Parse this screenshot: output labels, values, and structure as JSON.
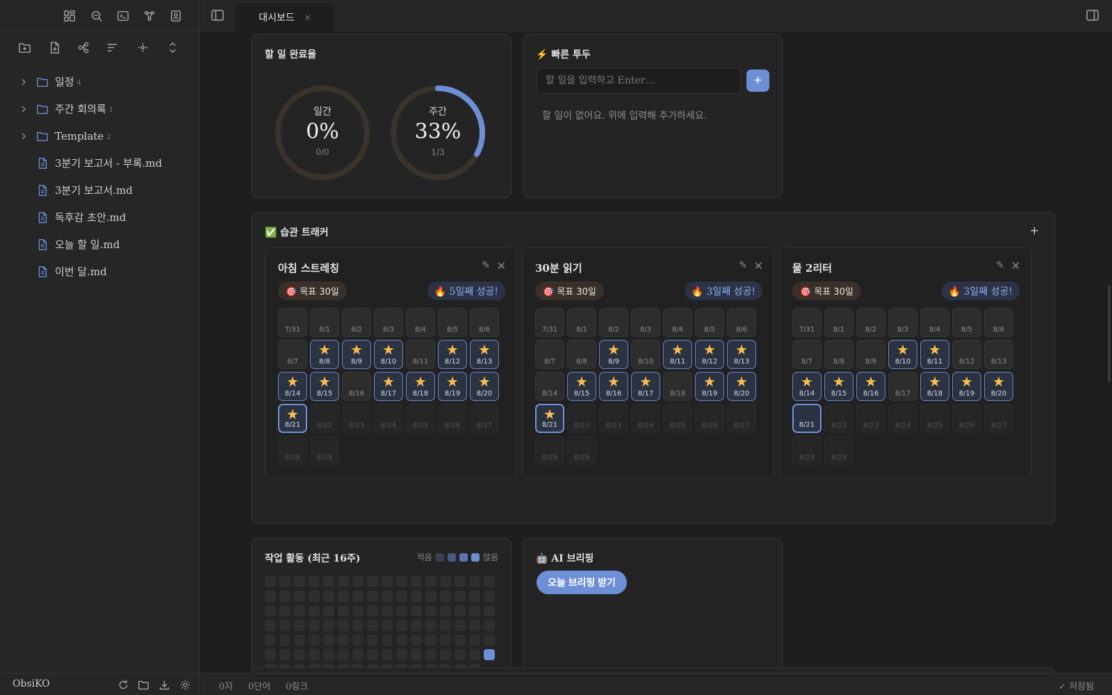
{
  "sidebar": {
    "tree": [
      {
        "type": "folder",
        "label": "일정",
        "count": "4"
      },
      {
        "type": "folder",
        "label": "주간 회의록",
        "count": "1"
      },
      {
        "type": "folder",
        "label": "Template",
        "count": "2"
      },
      {
        "type": "file",
        "label": "3분기 보고서 - 부록.md"
      },
      {
        "type": "file",
        "label": "3분기 보고서.md"
      },
      {
        "type": "file",
        "label": "독후감 초안.md"
      },
      {
        "type": "file",
        "label": "오늘 할 일.md"
      },
      {
        "type": "file",
        "label": "이번 달.md"
      }
    ],
    "vault_name": "ObsiKO"
  },
  "tab": {
    "title": "대시보드",
    "close": "×"
  },
  "completion": {
    "title": "할 일 완료율",
    "daily": {
      "name": "일간",
      "pct": "0%",
      "frac": "0/0",
      "value": 0
    },
    "weekly": {
      "name": "주간",
      "pct": "33%",
      "frac": "1/3",
      "value": 0.33
    }
  },
  "quicktodo": {
    "title": "⚡ 빠른 투두",
    "placeholder": "할 일을 입력하고 Enter…",
    "add_label": "+",
    "empty": "할 일이 없어요. 위에 입력해 추가하세요."
  },
  "habits": {
    "title": "✅ 습관 트래커",
    "add_label": "+",
    "edit_icon": "✎",
    "delete_icon": "✕",
    "dates": [
      "7/31",
      "8/1",
      "8/2",
      "8/3",
      "8/4",
      "8/5",
      "8/6",
      "8/7",
      "8/8",
      "8/9",
      "8/10",
      "8/11",
      "8/12",
      "8/13",
      "8/14",
      "8/15",
      "8/16",
      "8/17",
      "8/18",
      "8/19",
      "8/20",
      "8/21",
      "8/22",
      "8/23",
      "8/24",
      "8/25",
      "8/26",
      "8/27",
      "8/28",
      "8/29"
    ],
    "today_index": 21,
    "items": [
      {
        "name": "아침 스트레칭",
        "goal": "🎯 목표 30일",
        "streak": "🔥 5일째 성공!",
        "done": [
          8,
          9,
          10,
          12,
          13,
          14,
          15,
          17,
          18,
          19,
          20,
          21
        ]
      },
      {
        "name": "30분 읽기",
        "goal": "🎯 목표 30일",
        "streak": "🔥 3일째 성공!",
        "done": [
          9,
          11,
          12,
          13,
          15,
          16,
          17,
          19,
          20,
          21
        ]
      },
      {
        "name": "물 2리터",
        "goal": "🎯 목표 30일",
        "streak": "🔥 3일째 성공!",
        "done": [
          10,
          11,
          14,
          15,
          16,
          18,
          19,
          20
        ]
      }
    ]
  },
  "activity": {
    "title": "작업 활동 (최근 16주)",
    "legend_less": "적음",
    "legend_more": "많음",
    "legend_colors": [
      "#3b4150",
      "#4a5a82",
      "#5a74b6",
      "#6e8fd6"
    ],
    "weeks": 16,
    "days": 7,
    "empty_color": "#2f2f2f",
    "active": [
      {
        "week": 15,
        "day": 5,
        "level": 4
      }
    ]
  },
  "ai": {
    "title": "🤖 AI 브리핑",
    "button": "오늘 브리핑 받기"
  },
  "status": {
    "chars": "0자",
    "words": "0단어",
    "links": "0링크",
    "saved": "✓ 저장됨"
  },
  "colors": {
    "accent": "#6e8fd6",
    "star": "#f2c14e",
    "ring_track": "#3a332c"
  }
}
